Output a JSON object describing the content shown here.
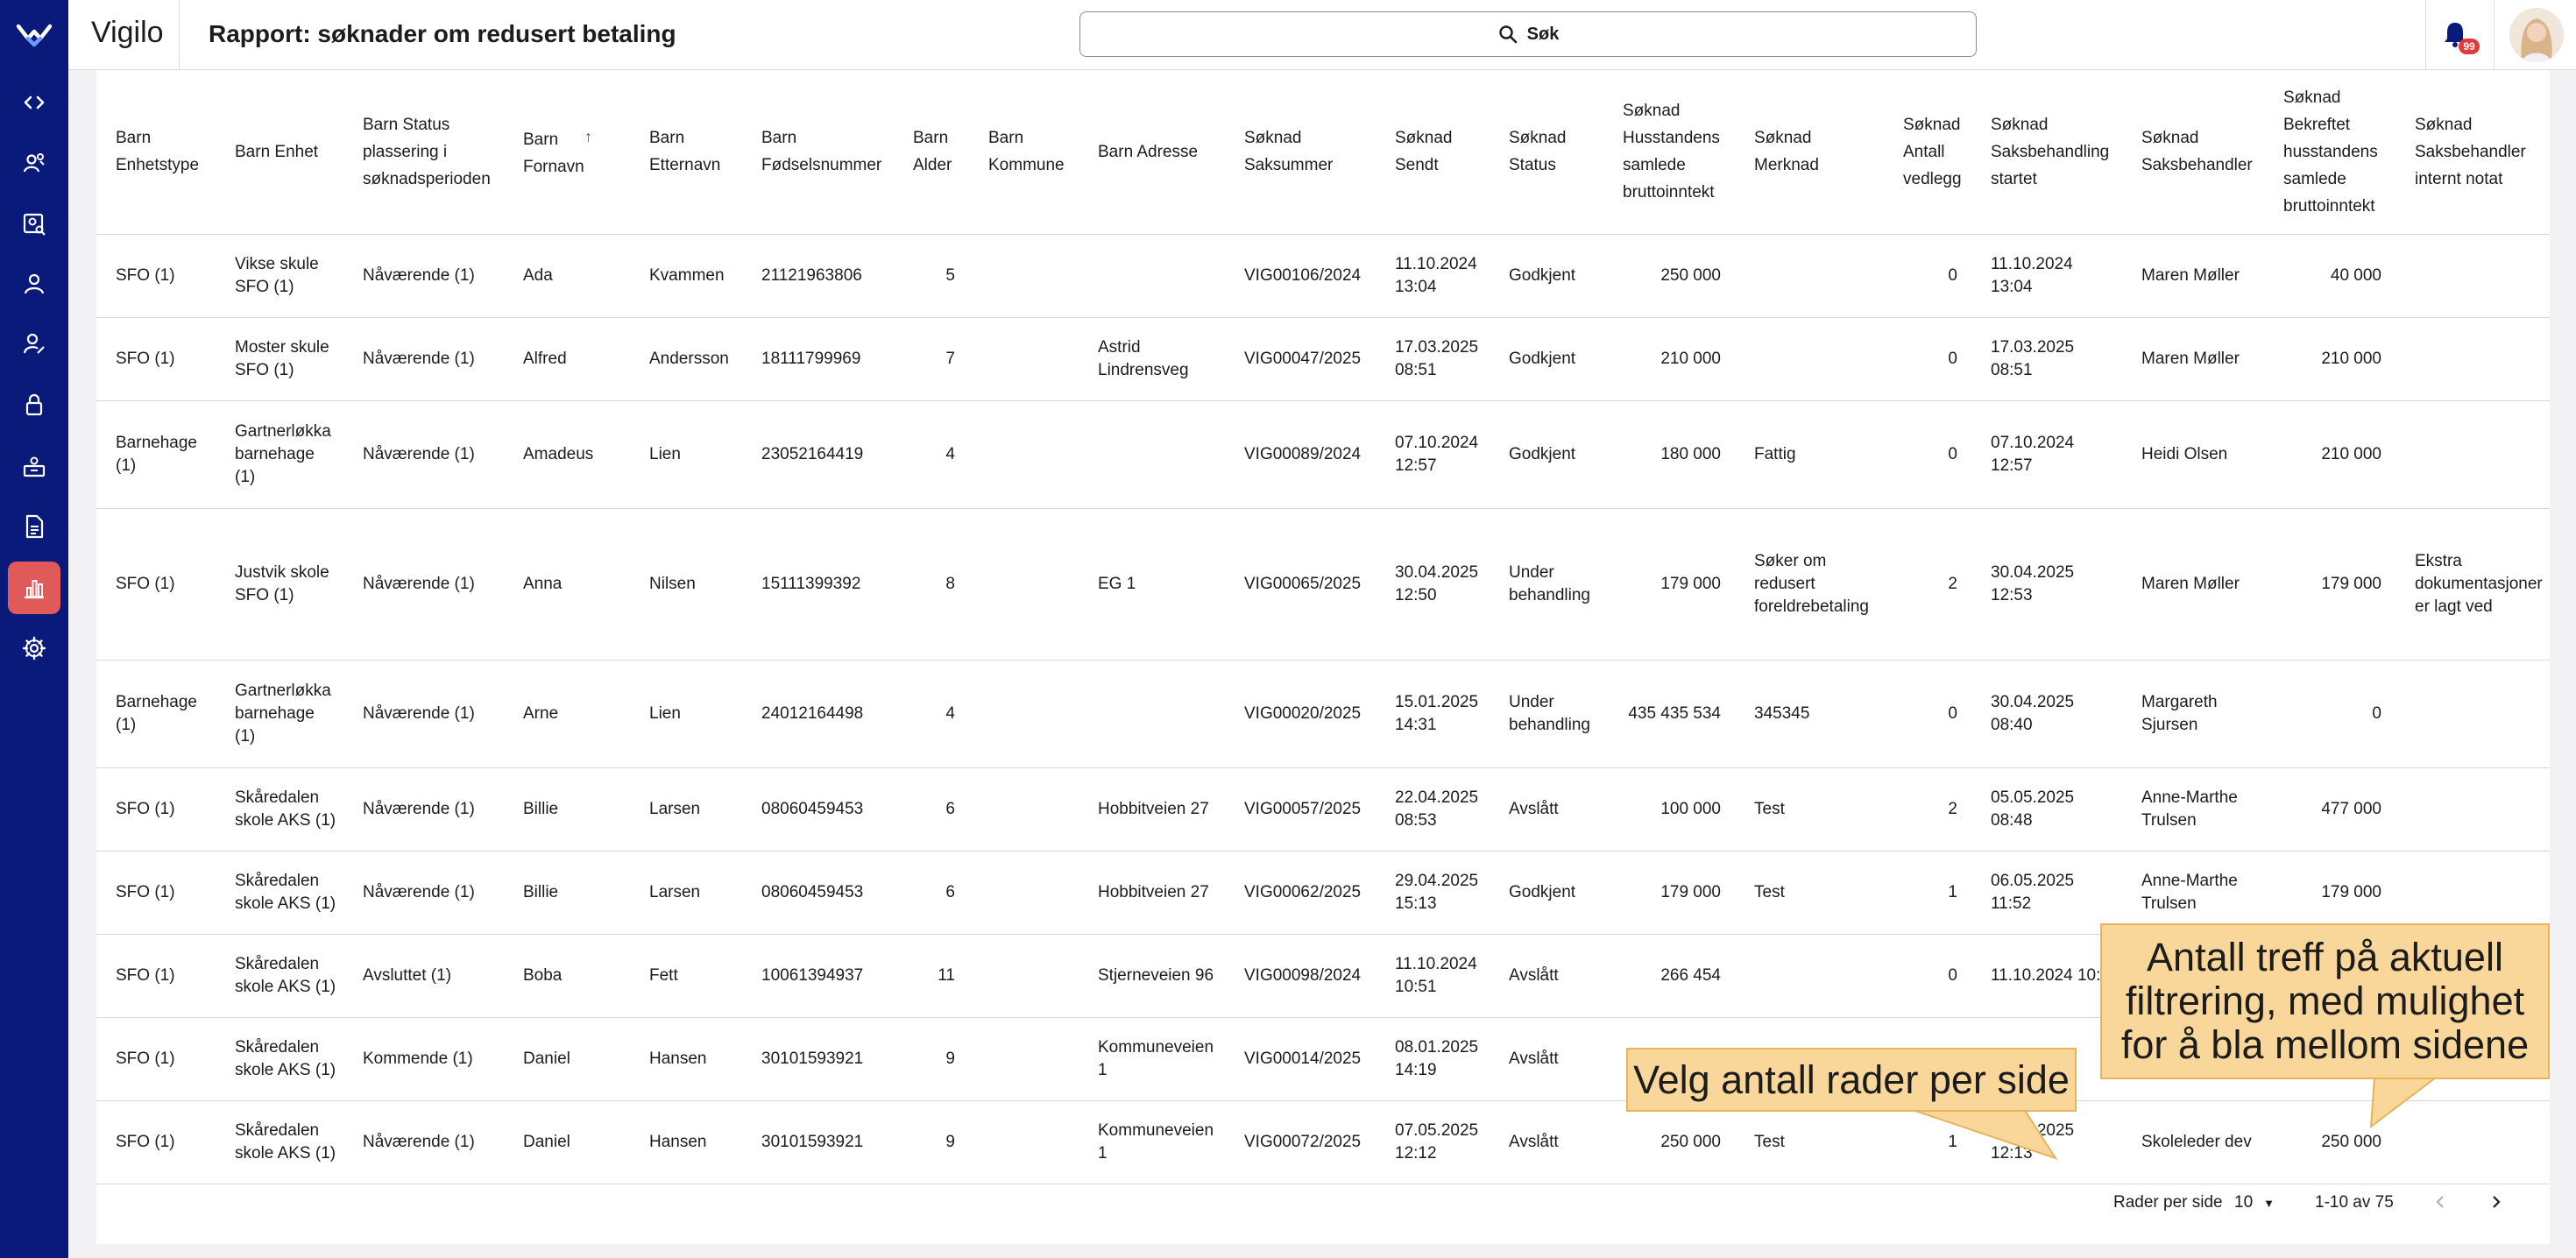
{
  "app": {
    "brand": "Vigilo",
    "page_title": "Rapport: søknader om redusert betaling"
  },
  "search": {
    "label": "Søk"
  },
  "notifications": {
    "count": "99"
  },
  "nav": {
    "icons": [
      "code-icon",
      "people-icon",
      "person-search-icon",
      "person-icon",
      "person-edit-icon",
      "lock-icon",
      "inbox-icon",
      "document-icon",
      "report-chart-icon",
      "gear-icon"
    ],
    "active": "report-chart-icon"
  },
  "colors": {
    "rail": "#0a1a7a",
    "active_nav": "#e05a5a",
    "callout_bg": "#f9d79a",
    "badge": "#e23b3b"
  },
  "table": {
    "headers": [
      "Barn Enhetstype",
      "Barn Enhet",
      "Barn Status plassering i søknadsperioden",
      "Barn Fornavn",
      "Barn Etternavn",
      "Barn Fødselsnummer",
      "Barn Alder",
      "Barn Kommune",
      "Barn Adresse",
      "Søknad Saksummer",
      "Søknad Sendt",
      "Søknad Status",
      "Søknad Husstandens samlede bruttoinntekt",
      "Søknad Merknad",
      "Søknad Antall vedlegg",
      "Søknad Saksbehandling startet",
      "Søknad Saksbehandler",
      "Søknad Bekreftet husstandens samlede bruttoinntekt",
      "Søknad Saksbehandler internt notat"
    ],
    "sorted_column": "Barn Fornavn",
    "rows": [
      [
        "SFO (1)",
        "Vikse skule SFO (1)",
        "Nåværende (1)",
        "Ada",
        "Kvammen",
        "21121963806",
        "5",
        "",
        "",
        "VIG00106/2024",
        "11.10.2024 13:04",
        "Godkjent",
        "250 000",
        "",
        "0",
        "11.10.2024 13:04",
        "Maren Møller",
        "40 000",
        ""
      ],
      [
        "SFO (1)",
        "Moster skule SFO (1)",
        "Nåværende (1)",
        "Alfred",
        "Andersson",
        "18111799969",
        "7",
        "",
        "Astrid Lindrensveg",
        "VIG00047/2025",
        "17.03.2025 08:51",
        "Godkjent",
        "210 000",
        "",
        "0",
        "17.03.2025 08:51",
        "Maren Møller",
        "210 000",
        ""
      ],
      [
        "Barnehage (1)",
        "Gartnerløkka barnehage (1)",
        "Nåværende (1)",
        "Amadeus",
        "Lien",
        "23052164419",
        "4",
        "",
        "",
        "VIG00089/2024",
        "07.10.2024 12:57",
        "Godkjent",
        "180 000",
        "Fattig",
        "0",
        "07.10.2024 12:57",
        "Heidi Olsen",
        "210 000",
        ""
      ],
      [
        "SFO (1)",
        "Justvik skole SFO (1)",
        "Nåværende (1)",
        "Anna",
        "Nilsen",
        "15111399392",
        "8",
        "",
        "EG 1",
        "VIG00065/2025",
        "30.04.2025 12:50",
        "Under behandling",
        "179 000",
        "Søker om redusert foreldrebetaling",
        "2",
        "30.04.2025 12:53",
        "Maren Møller",
        "179 000",
        "Ekstra dokumentasjoner er lagt ved"
      ],
      [
        "Barnehage (1)",
        "Gartnerløkka barnehage (1)",
        "Nåværende (1)",
        "Arne",
        "Lien",
        "24012164498",
        "4",
        "",
        "",
        "VIG00020/2025",
        "15.01.2025 14:31",
        "Under behandling",
        "435 435 534",
        "345345",
        "0",
        "30.04.2025 08:40",
        "Margareth Sjursen",
        "0",
        ""
      ],
      [
        "SFO (1)",
        "Skåredalen skole AKS (1)",
        "Nåværende (1)",
        "Billie",
        "Larsen",
        "08060459453",
        "6",
        "",
        "Hobbitveien 27",
        "VIG00057/2025",
        "22.04.2025 08:53",
        "Avslått",
        "100 000",
        "Test",
        "2",
        "05.05.2025 08:48",
        "Anne-Marthe Trulsen",
        "477 000",
        ""
      ],
      [
        "SFO (1)",
        "Skåredalen skole AKS (1)",
        "Nåværende (1)",
        "Billie",
        "Larsen",
        "08060459453",
        "6",
        "",
        "Hobbitveien 27",
        "VIG00062/2025",
        "29.04.2025 15:13",
        "Godkjent",
        "179 000",
        "Test",
        "1",
        "06.05.2025 11:52",
        "Anne-Marthe Trulsen",
        "179 000",
        ""
      ],
      [
        "SFO (1)",
        "Skåredalen skole AKS (1)",
        "Avsluttet (1)",
        "Boba",
        "Fett",
        "10061394937",
        "11",
        "",
        "Stjerneveien 96",
        "VIG00098/2024",
        "11.10.2024 10:51",
        "Avslått",
        "266 454",
        "",
        "0",
        "11.10.2024 10:5",
        "",
        "",
        ""
      ],
      [
        "SFO (1)",
        "Skåredalen skole AKS (1)",
        "Kommende (1)",
        "Daniel",
        "Hansen",
        "30101593921",
        "9",
        "",
        "Kommuneveien 1",
        "VIG00014/2025",
        "08.01.2025 14:19",
        "Avslått",
        "",
        "",
        "",
        "08.01.2025",
        "",
        "",
        ""
      ],
      [
        "SFO (1)",
        "Skåredalen skole AKS (1)",
        "Nåværende (1)",
        "Daniel",
        "Hansen",
        "30101593921",
        "9",
        "",
        "Kommuneveien 1",
        "VIG00072/2025",
        "07.05.2025 12:12",
        "Avslått",
        "250 000",
        "Test",
        "1",
        "07.05.2025 12:13",
        "Skoleleder dev",
        "250 000",
        ""
      ]
    ]
  },
  "pagination": {
    "rows_per_page_label": "Rader per side",
    "rows_per_page": "10",
    "range": "1-10 av 75"
  },
  "annotations": {
    "pagination_note": "Antall treff på aktuell filtrering, med mulighet for å bla mellom sidene",
    "rows_note": "Velg antall rader per side"
  }
}
